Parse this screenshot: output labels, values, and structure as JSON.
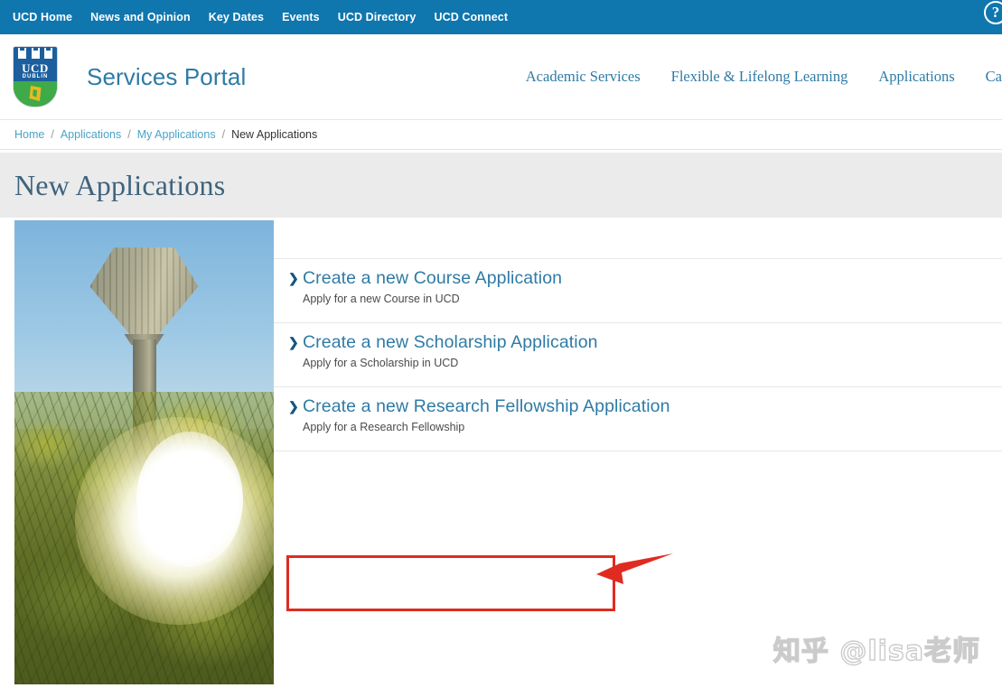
{
  "topbar": {
    "links": [
      {
        "label": "UCD Home"
      },
      {
        "label": "News and Opinion"
      },
      {
        "label": "Key Dates"
      },
      {
        "label": "Events"
      },
      {
        "label": "UCD Directory"
      },
      {
        "label": "UCD Connect"
      }
    ],
    "help_icon": "?",
    "background_color": "#0f76ae"
  },
  "masthead": {
    "logo": {
      "ucd_text": "UCD",
      "dublin_text": "DUBLIN"
    },
    "portal_title": "Services Portal",
    "nav": [
      {
        "label": "Academic Services"
      },
      {
        "label": "Flexible & Lifelong Learning"
      },
      {
        "label": "Applications"
      },
      {
        "label": "Ca"
      }
    ]
  },
  "breadcrumb": {
    "items": [
      {
        "label": "Home",
        "current": false
      },
      {
        "label": "Applications",
        "current": false
      },
      {
        "label": "My Applications",
        "current": false
      },
      {
        "label": "New Applications",
        "current": true
      }
    ],
    "separator": "/"
  },
  "page": {
    "title": "New Applications"
  },
  "applications": [
    {
      "chevron": "❯",
      "title": "Create a new Course Application",
      "subtitle": "Apply for a new Course in UCD",
      "highlighted": false
    },
    {
      "chevron": "❯",
      "title": "Create a new Scholarship Application",
      "subtitle": "Apply for a Scholarship in UCD",
      "highlighted": true
    },
    {
      "chevron": "❯",
      "title": "Create a new Research Fellowship Application",
      "subtitle": "Apply for a Research Fellowship",
      "highlighted": false
    }
  ],
  "annotation": {
    "highlight_color": "#e02b20",
    "arrow_color": "#e02b20"
  },
  "watermark": {
    "text": "知乎 @lisa老师"
  },
  "photo": {
    "alt": "UCD campus water tower at sunset behind autumn trees"
  },
  "colors": {
    "topbar_blue": "#0f76ae",
    "link_blue": "#2e7ba6",
    "crumb_blue": "#4ba3c7",
    "title_slate": "#3f637d",
    "band_grey": "#ebebeb"
  }
}
